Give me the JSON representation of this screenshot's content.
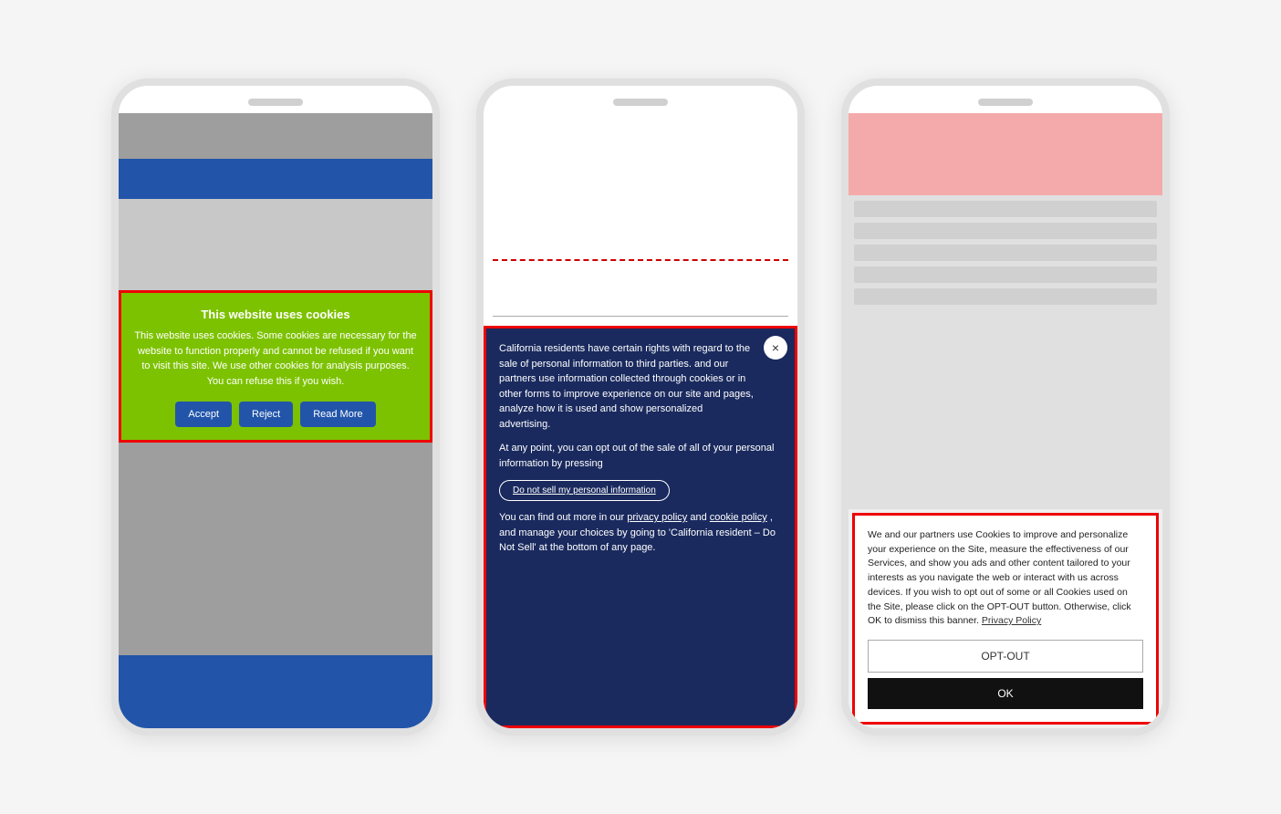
{
  "phone1": {
    "speaker": "",
    "cookie_banner": {
      "title": "This website uses cookies",
      "text": "This website uses cookies. Some cookies are necessary for the website to function properly and cannot be refused if you want to visit this site. We use other cookies for analysis purposes. You can refuse this if you wish.",
      "btn_accept": "Accept",
      "btn_reject": "Reject",
      "btn_read_more": "Read More"
    }
  },
  "phone2": {
    "speaker": "",
    "cookie_banner": {
      "text1": "California residents have certain rights with regard to the sale of personal information to third parties.            and our partners use information collected through cookies or in other forms to improve experience on our site and pages, analyze how it is used and show personalized advertising.",
      "text2": "At any point, you can opt out of the sale of all of your personal information by pressing",
      "do_not_sell_btn_prefix": "Do not sell my personal ",
      "do_not_sell_btn_link": "information",
      "text3": "You can find out more in our",
      "privacy_policy_link": "privacy policy",
      "and": "and",
      "cookie_policy_link": "cookie policy",
      "text3_end": ", and manage your choices by going to 'California resident – Do Not Sell' at the bottom of any page.",
      "close_icon": "×"
    }
  },
  "phone3": {
    "speaker": "",
    "cookie_banner": {
      "text": "We and our partners use Cookies to improve and personalize your experience on the Site, measure the effectiveness of our Services, and show you ads and other content tailored to your interests as you navigate the web or interact with us across devices. If you wish to opt out of some or all Cookies used on the Site, please click on the OPT-OUT button. Otherwise, click OK to dismiss this banner.",
      "privacy_policy_link": "Privacy Policy",
      "opt_out_label": "OPT-OUT",
      "ok_label": "OK"
    }
  }
}
